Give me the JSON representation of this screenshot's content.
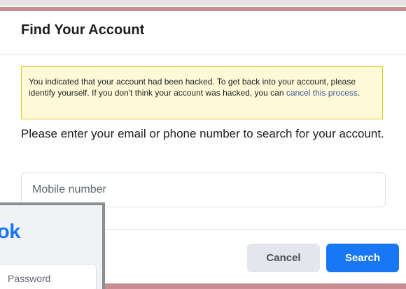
{
  "dialog": {
    "title": "Find Your Account",
    "notice": {
      "text": "You indicated that your account had been hacked. To get back into your account, please identify yourself. If you don't think your account was hacked, you can ",
      "link_label": "cancel this process",
      "trailing": "."
    },
    "instructions": "Please enter your email or phone number to search for your account.",
    "search_input": {
      "placeholder": "Mobile number",
      "value": ""
    },
    "buttons": {
      "cancel_label": "Cancel",
      "search_label": "Search"
    }
  },
  "background_window": {
    "logo_fragment": "ok",
    "password_placeholder": "Password"
  },
  "colors": {
    "primary": "#1877f2",
    "notice_bg": "#fff9d7",
    "notice_border": "#e2c822",
    "link": "#385898"
  }
}
